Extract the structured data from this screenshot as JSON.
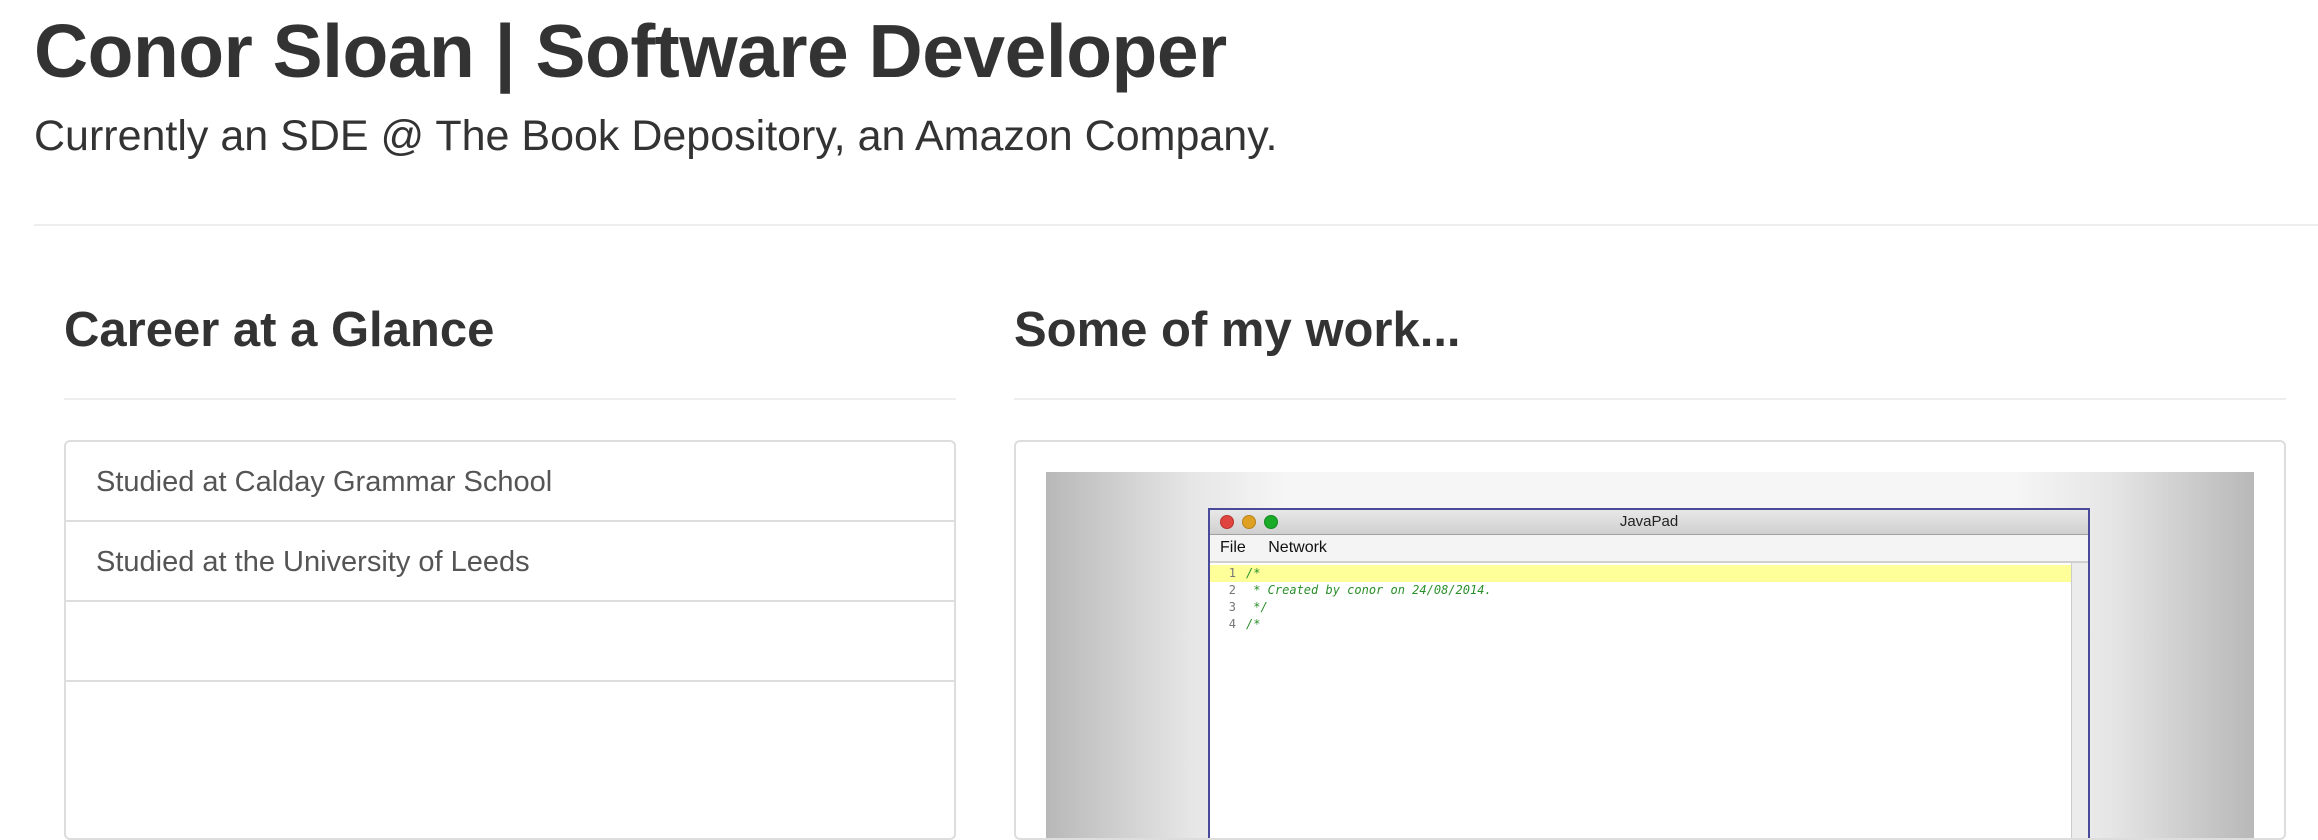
{
  "header": {
    "title": "Conor Sloan | Software Developer",
    "subtitle": "Currently an SDE @ The Book Depository, an Amazon Company."
  },
  "career": {
    "heading": "Career at a Glance",
    "items": [
      {
        "label": "Studied at Calday Grammar School"
      },
      {
        "label": "Studied at the University of Leeds"
      }
    ]
  },
  "work": {
    "heading": "Some of my work...",
    "screenshot": {
      "window_title": "JavaPad",
      "menu": [
        "File",
        "Network"
      ],
      "lines": [
        {
          "num": "1",
          "text": "/*"
        },
        {
          "num": "2",
          "text": " * Created by conor on 24/08/2014."
        },
        {
          "num": "3",
          "text": " */"
        },
        {
          "num": "4",
          "text": "/*"
        }
      ]
    }
  }
}
